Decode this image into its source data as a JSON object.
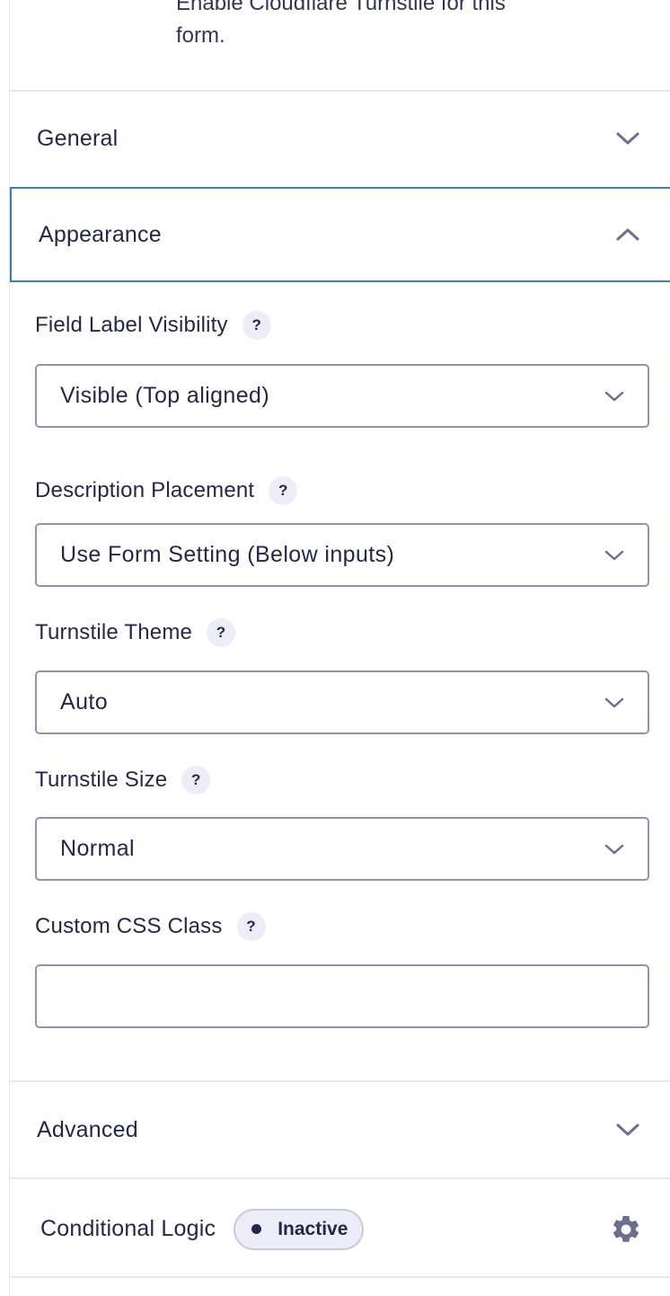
{
  "intro_text": "Enable Cloudflare Turnstile for this form.",
  "sections": {
    "general": {
      "title": "General",
      "icon": "chevron-down-icon"
    },
    "appearance": {
      "title": "Appearance",
      "icon": "chevron-up-icon"
    },
    "advanced": {
      "title": "Advanced",
      "icon": "chevron-down-icon"
    }
  },
  "appearance": {
    "field_label_visibility": {
      "label": "Field Label Visibility",
      "help": "?",
      "value": "Visible (Top aligned)"
    },
    "description_placement": {
      "label": "Description Placement",
      "help": "?",
      "value": "Use Form Setting (Below inputs)"
    },
    "turnstile_theme": {
      "label": "Turnstile Theme",
      "help": "?",
      "value": "Auto"
    },
    "turnstile_size": {
      "label": "Turnstile Size",
      "help": "?",
      "value": "Normal"
    },
    "custom_css_class": {
      "label": "Custom CSS Class",
      "help": "?",
      "value": ""
    }
  },
  "conditional_logic": {
    "title": "Conditional Logic",
    "status": "Inactive",
    "icon": "gear-icon"
  },
  "colors": {
    "accent": "#3e7da6",
    "text": "#242748",
    "border": "#9092b2",
    "badge_bg": "#ecedf8"
  }
}
